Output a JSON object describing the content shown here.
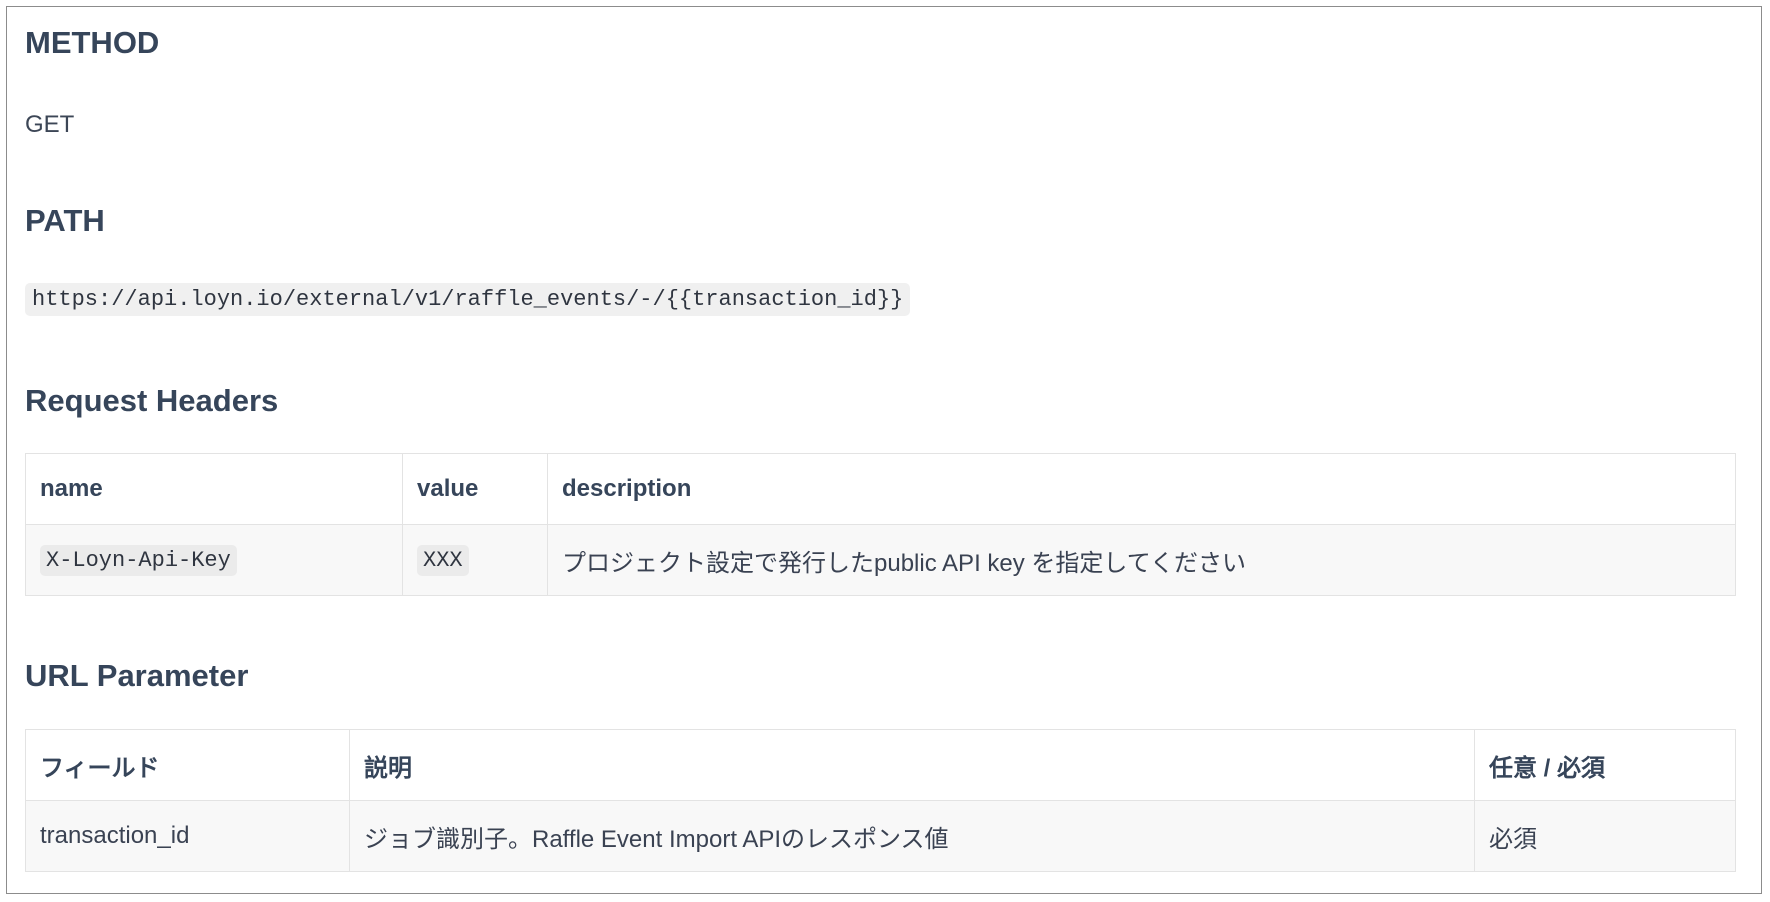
{
  "method": {
    "heading": "METHOD",
    "value": "GET"
  },
  "path": {
    "heading": "PATH",
    "url": "https://api.loyn.io/external/v1/raffle_events/-/{{transaction_id}}"
  },
  "request_headers": {
    "heading": "Request Headers",
    "columns": [
      "name",
      "value",
      "description"
    ],
    "rows": [
      {
        "name": "X-Loyn-Api-Key",
        "value": "XXX",
        "description": "プロジェクト設定で発行したpublic API key を指定してください"
      }
    ]
  },
  "url_parameter": {
    "heading": "URL Parameter",
    "columns": [
      "フィールド",
      "説明",
      "任意 / 必須"
    ],
    "rows": [
      {
        "field": "transaction_id",
        "description": "ジョブ識別子。Raffle Event Import APIのレスポンス値",
        "required": "必須"
      }
    ]
  }
}
